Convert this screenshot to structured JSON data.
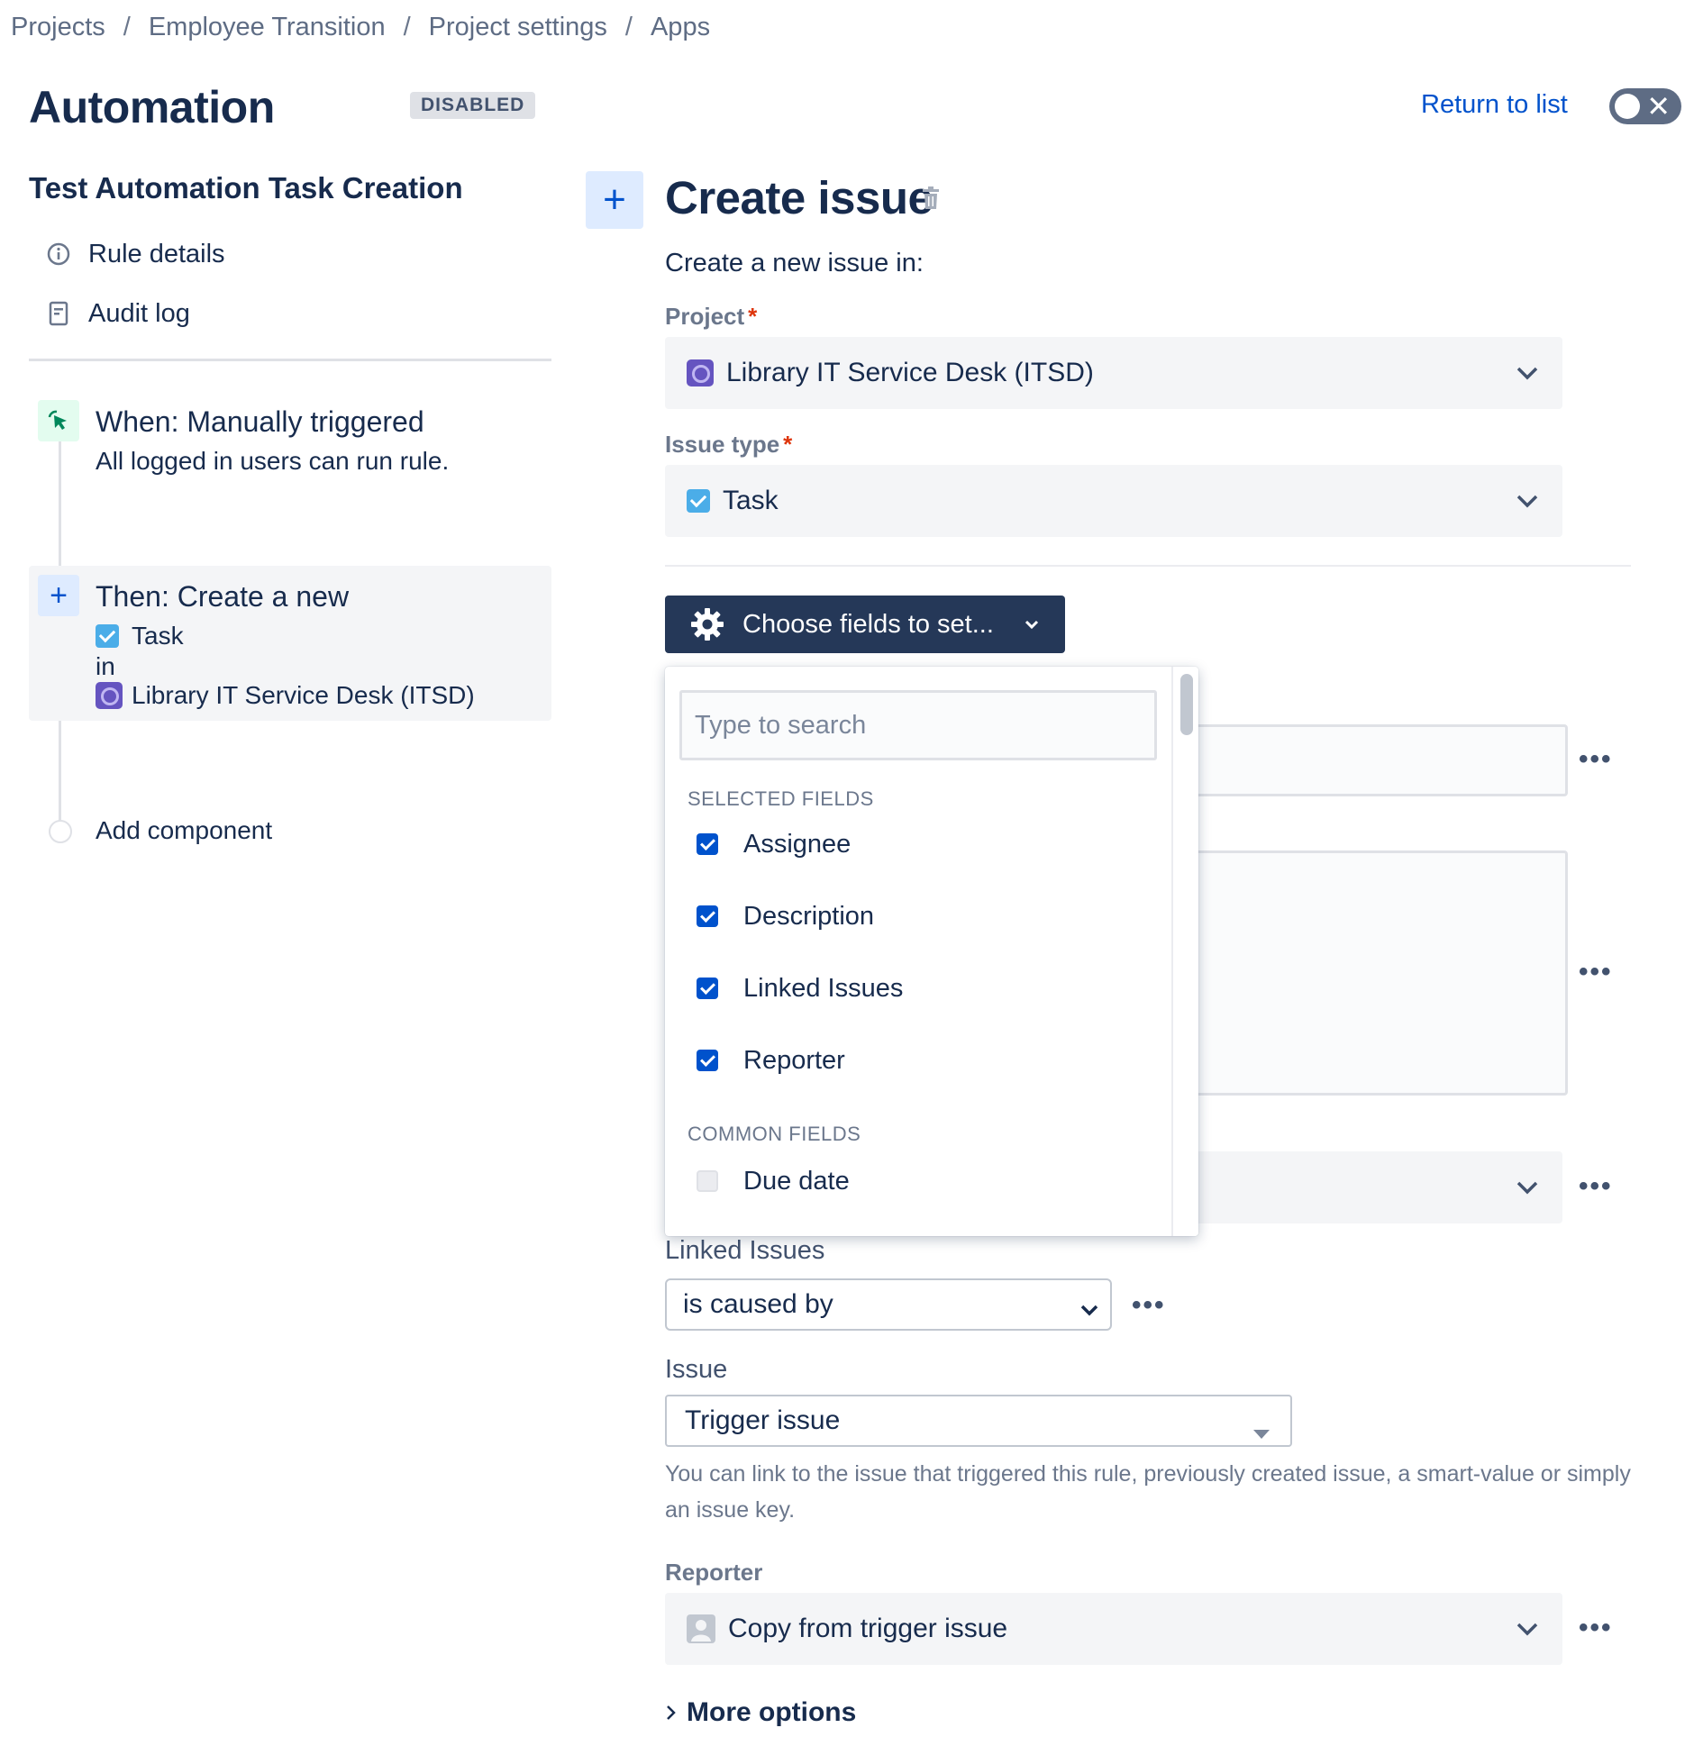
{
  "breadcrumb": [
    "Projects",
    "Employee Transition",
    "Project settings",
    "Apps"
  ],
  "breadcrumb_separator": "/",
  "header": {
    "title": "Automation",
    "status_badge": "DISABLED",
    "return_link": "Return to list",
    "toggle_on": false
  },
  "sidebar": {
    "rule_name": "Test Automation Task Creation",
    "links": [
      {
        "label": "Rule details",
        "icon": "info-icon"
      },
      {
        "label": "Audit log",
        "icon": "document-icon"
      }
    ],
    "trigger": {
      "title": "When: Manually triggered",
      "subtitle": "All logged in users can run rule."
    },
    "action": {
      "title": "Then: Create a new",
      "issue_type": "Task",
      "joiner": "in",
      "project": "Library IT Service Desk (ITSD)"
    },
    "add_component": "Add component"
  },
  "editor": {
    "title": "Create issue",
    "intro": "Create a new issue in:",
    "project_label": "Project",
    "project_value": "Library IT Service Desk (ITSD)",
    "issue_type_label": "Issue type",
    "issue_type_value": "Task",
    "required_marker": "*",
    "choose_fields_button": "Choose fields to set...",
    "linked_issues_label": "Linked Issues",
    "link_type_value": "is caused by",
    "issue_label": "Issue",
    "issue_value": "Trigger issue",
    "issue_helper": "You can link to the issue that triggered this rule, previously created issue, a smart-value or simply an issue key.",
    "reporter_label": "Reporter",
    "reporter_value": "Copy from trigger issue",
    "more_options": "More options",
    "more_actions": "•••"
  },
  "fields_dropdown": {
    "search_placeholder": "Type to search",
    "selected_heading": "SELECTED FIELDS",
    "selected": [
      "Assignee",
      "Description",
      "Linked Issues",
      "Reporter"
    ],
    "common_heading": "COMMON FIELDS",
    "common": [
      "Due date"
    ]
  },
  "colors": {
    "primary": "#0052cc",
    "dark_button": "#253858",
    "required": "#de350b",
    "task_icon": "#4bade8",
    "project_icon": "#6554c0"
  }
}
